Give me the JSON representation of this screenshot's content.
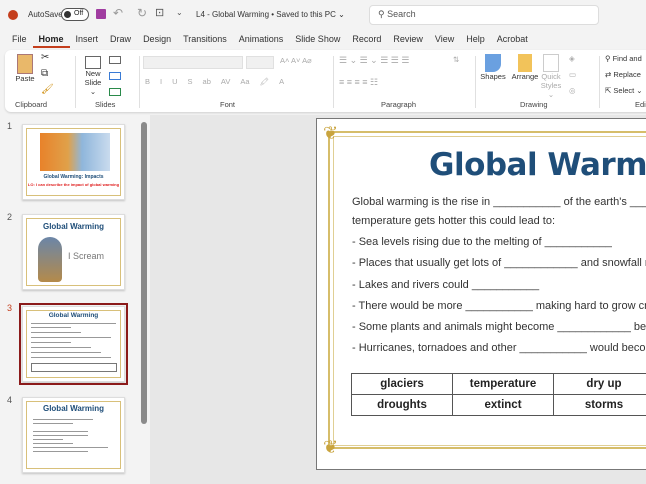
{
  "titlebar": {
    "autosave": "AutoSave",
    "toggle": "Off",
    "doc_title": "L4 - Global Warming • Saved to this PC ⌄",
    "search_placeholder": "Search"
  },
  "tabs": [
    "File",
    "Home",
    "Insert",
    "Draw",
    "Design",
    "Transitions",
    "Animations",
    "Slide Show",
    "Record",
    "Review",
    "View",
    "Help",
    "Acrobat"
  ],
  "ribbon": {
    "paste": "Paste",
    "new_slide": "New",
    "new_slide2": "Slide ⌄",
    "shapes": "Shapes",
    "arrange": "Arrange",
    "quick_styles": "Quick",
    "quick_styles2": "Styles ⌄",
    "find": "Find and",
    "replace": "Replace",
    "select": "Select ⌄",
    "groups": {
      "clipboard": "Clipboard",
      "slides": "Slides",
      "font": "Font",
      "paragraph": "Paragraph",
      "drawing": "Drawing",
      "editing": "Editing"
    },
    "font_buttons": [
      "B",
      "I",
      "U",
      "S",
      "ab",
      "AV",
      "Aa"
    ]
  },
  "thumbnails": [
    {
      "num": "1",
      "title": "Global Warming: Impacts",
      "subtitle": "LO: I can describe the impact of global warming"
    },
    {
      "num": "2",
      "title": "Global Warming",
      "caption": "I Scream"
    },
    {
      "num": "3",
      "title": "Global Warming",
      "selected": true
    },
    {
      "num": "4",
      "title": "Global Warming"
    }
  ],
  "slide": {
    "title": "Global Warming",
    "lines": [
      "Global warming is the rise in ___________ of the earth's ______",
      "temperature gets hotter this could lead to:",
      "- Sea levels rising due to the melting of ___________",
      "- Places that usually get lots of ____________ and snowfall mig",
      "- Lakes and rivers could ___________",
      "- There would be more ___________ making hard to grow crops",
      "- Some plants and animals might become ____________ becaus",
      "- Hurricanes, tornadoes and other ___________ would become m"
    ],
    "table": [
      [
        "glaciers",
        "temperature",
        "dry up"
      ],
      [
        "droughts",
        "extinct",
        "storms"
      ]
    ]
  },
  "colors": {
    "accent": "#c43e1c",
    "title": "#1f4e79",
    "gold": "#d6bd6a",
    "selected": "#8b1a1a"
  }
}
